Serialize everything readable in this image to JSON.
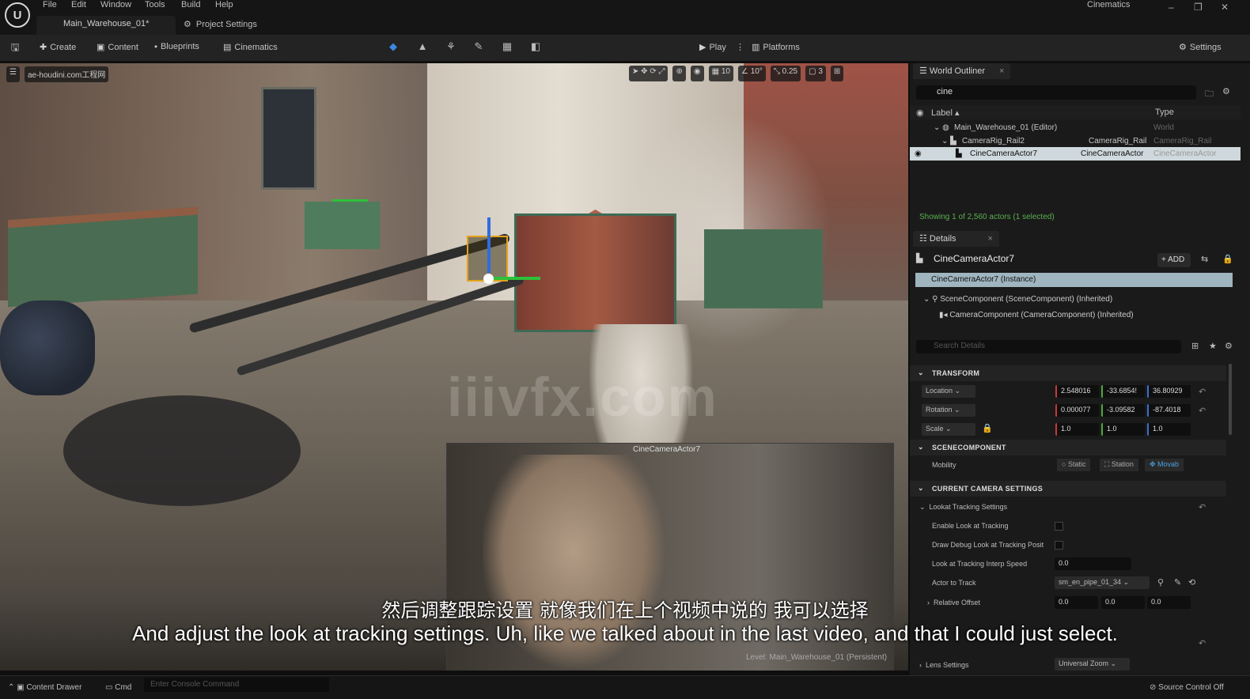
{
  "menubar": {
    "logo": "U",
    "items": [
      "File",
      "Edit",
      "Window",
      "Tools",
      "Build",
      "Help"
    ],
    "doc_tab": "Main_Warehouse_01*",
    "project_tab": "Project Settings",
    "window_title": "Cinematics"
  },
  "toolbar": {
    "create": "Create",
    "content": "Content",
    "blueprints": "Blueprints",
    "cinematics": "Cinematics",
    "play": "Play",
    "platforms": "Platforms",
    "settings": "Settings"
  },
  "viewport": {
    "overlay_text": "ae-houdini.com工程网",
    "tools": [
      "10",
      "10°",
      "0.25",
      "3"
    ],
    "pip_label": "CineCameraActor7",
    "level_label": "Level: Main_Warehouse_01 (Persistent)",
    "watermark": "iiivfx.com"
  },
  "subtitles": {
    "zh": "然后调整跟踪设置 就像我们在上个视频中说的 我可以选择",
    "en": "And adjust the look at tracking settings. Uh, like we talked about in the last video, and that I could just select."
  },
  "outliner": {
    "tab": "World Outliner",
    "search_value": "cine",
    "col_label": "Label",
    "col_type": "Type",
    "rows": [
      {
        "label": "Main_Warehouse_01 (Editor)",
        "type": "World"
      },
      {
        "label": "CameraRig_Rail2",
        "type": "CameraRig_Rail",
        "type2": "CameraRig_Rail"
      },
      {
        "label": "CineCameraActor7",
        "type": "CineCameraActor",
        "type2": "CineCameraActor"
      }
    ],
    "status": "Showing 1 of 2,560 actors (1 selected)"
  },
  "details": {
    "tab": "Details",
    "title": "CineCameraActor7",
    "add": "+ ADD",
    "instance": "CineCameraActor7 (Instance)",
    "scene_component": "SceneComponent (SceneComponent) (Inherited)",
    "camera_component": "CameraComponent (CameraComponent) (Inherited)",
    "search_placeholder": "Search Details",
    "transform": {
      "header": "TRANSFORM",
      "location_label": "Location",
      "rotation_label": "Rotation",
      "scale_label": "Scale",
      "location": [
        "2.548016",
        "-33.6854!",
        "36.80929"
      ],
      "rotation": [
        "0.000077",
        "-3.09582",
        "-87.4018"
      ],
      "scale": [
        "1.0",
        "1.0",
        "1.0"
      ]
    },
    "scenecomponent": {
      "header": "SCENECOMPONENT",
      "mobility_label": "Mobility",
      "options": [
        "Static",
        "Station",
        "Movab"
      ]
    },
    "camera_settings": {
      "header": "CURRENT CAMERA SETTINGS",
      "lookat_group": "Lookat Tracking Settings",
      "enable_label": "Enable Look at Tracking",
      "debug_label": "Draw Debug Look at Tracking Posit",
      "interp_label": "Look at Tracking Interp Speed",
      "interp_value": "0.0",
      "actor_label": "Actor to Track",
      "actor_value": "sm_en_pipe_01_34",
      "offset_label": "Relative Offset",
      "offset": [
        "0.0",
        "0.0",
        "0.0"
      ],
      "lens_label": "Lens Settings",
      "lens_value": "Universal Zoom"
    }
  },
  "statusbar": {
    "content_drawer": "Content Drawer",
    "cmd": "Cmd",
    "console_placeholder": "Enter Console Command",
    "source_control": "Source Control Off"
  }
}
